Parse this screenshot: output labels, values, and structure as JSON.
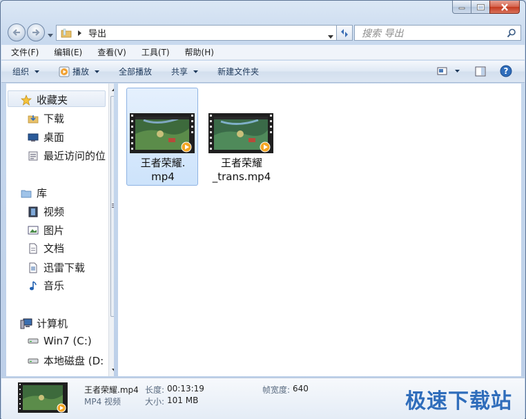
{
  "address": {
    "folder_name": "导出"
  },
  "search": {
    "placeholder": "搜索 导出"
  },
  "menu": [
    "文件(F)",
    "编辑(E)",
    "查看(V)",
    "工具(T)",
    "帮助(H)"
  ],
  "toolbar": {
    "organize": "组织",
    "play": "播放",
    "play_all": "全部播放",
    "share": "共享",
    "new_folder": "新建文件夹"
  },
  "nav": {
    "favorites": "收藏夹",
    "downloads": "下载",
    "desktop": "桌面",
    "recent": "最近访问的位",
    "libraries": "库",
    "videos": "视频",
    "pictures": "图片",
    "documents": "文档",
    "xunlei": "迅雷下载",
    "music": "音乐",
    "computer": "计算机",
    "drive_c": "Win7 (C:)",
    "drive_d": "本地磁盘 (D:"
  },
  "files": [
    {
      "line1": "王者荣耀.",
      "line2": "mp4",
      "selected": true
    },
    {
      "line1": "王者荣耀",
      "line2": "_trans.mp4",
      "selected": false
    }
  ],
  "details": {
    "name": "王者荣耀.mp4",
    "type": "MP4 视频",
    "duration_label": "长度:",
    "duration": "00:13:19",
    "size_label": "大小:",
    "size": "101 MB",
    "framewidth_label": "帧宽度:",
    "framewidth": "640"
  },
  "watermark": "极速下载站",
  "colors": {
    "accent": "#2f6dbb",
    "selection": "#cde3fb"
  }
}
